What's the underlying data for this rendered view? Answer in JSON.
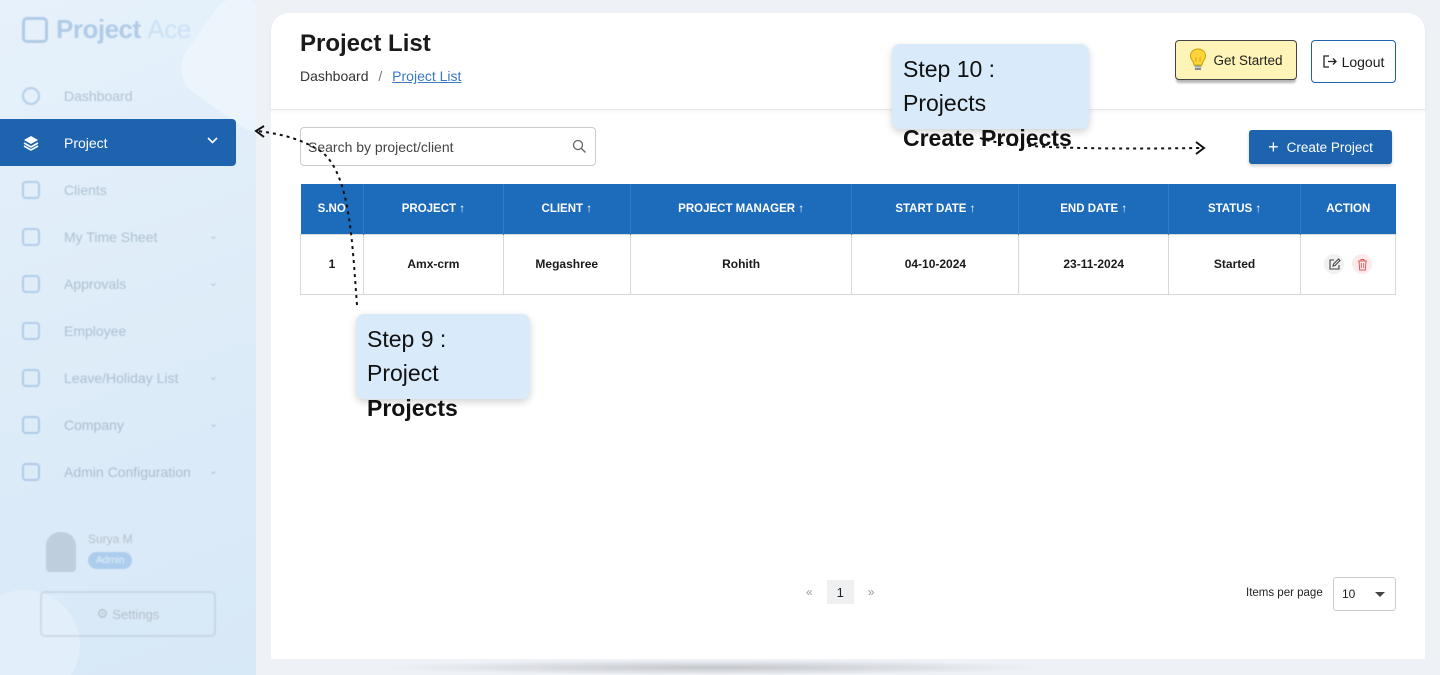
{
  "app": {
    "logo_main": "Project",
    "logo_accent": "Ace"
  },
  "sidebar": {
    "items": [
      {
        "label": "Dashboard",
        "icon": "dashboard-icon"
      },
      {
        "label": "Project",
        "icon": "layers-icon",
        "active": true
      },
      {
        "label": "Clients",
        "icon": "clients-icon"
      },
      {
        "label": "My Time Sheet",
        "icon": "timesheet-icon"
      },
      {
        "label": "Approvals",
        "icon": "calendar-icon"
      },
      {
        "label": "Employee",
        "icon": "employee-icon"
      },
      {
        "label": "Leave/Holiday List",
        "icon": "leave-icon"
      },
      {
        "label": "Company",
        "icon": "company-icon"
      },
      {
        "label": "Admin Configuration",
        "icon": "admin-icon"
      }
    ],
    "user": {
      "name": "Surya M",
      "role": "Admin"
    },
    "settings_label": "Settings"
  },
  "header": {
    "title": "Project List",
    "breadcrumb": {
      "home": "Dashboard",
      "separator": "/",
      "current": "Project List"
    },
    "get_started": "Get Started",
    "logout": "Logout"
  },
  "toolbar": {
    "search_placeholder": "Search by project/client",
    "create_label": "Create Project"
  },
  "table": {
    "columns": [
      "S.NO",
      "PROJECT ↑",
      "CLIENT ↑",
      "PROJECT MANAGER ↑",
      "START DATE ↑",
      "END DATE ↑",
      "STATUS ↑",
      "ACTION"
    ],
    "rows": [
      [
        "1",
        "Amx-crm",
        "Megashree",
        "Rohith",
        "04-10-2024",
        "23-11-2024",
        "Started"
      ]
    ]
  },
  "pagination": {
    "prev": "«",
    "current": "1",
    "next": "»",
    "items_per_page_label": "Items per page",
    "items_per_page": "10"
  },
  "tour": {
    "step9": {
      "line1": "Step 9 : Project",
      "line2": "Projects"
    },
    "step10": {
      "line1": "Step 10 : Projects",
      "line2": "Create Projects"
    }
  },
  "colors": {
    "primary": "#1d63ae",
    "tooltip": "#d9ebfb",
    "get_started_bg": "#fff4b8"
  }
}
